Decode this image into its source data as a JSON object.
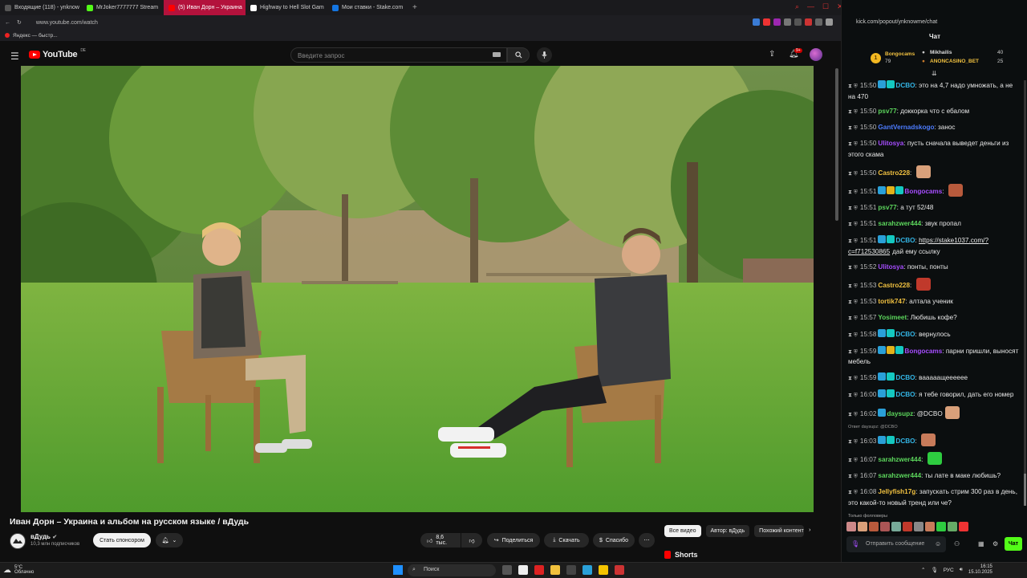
{
  "browser": {
    "tabs": [
      {
        "label": "Входящие (118) - ynknow",
        "color": "#555",
        "active": false
      },
      {
        "label": "MrJoker7777777 Stream",
        "color": "#53fc18",
        "active": false
      },
      {
        "label": "(5) Иван Дорн – Украина",
        "color": "#ff0000",
        "active": true
      },
      {
        "label": "Highway to Hell Slot Gam",
        "color": "#ffffff",
        "active": false
      },
      {
        "label": "Мои ставки - Stake.com",
        "color": "#1475e1",
        "active": false
      }
    ],
    "url": "www.youtube.com/watch",
    "bookmark": "Яндекс — быстр..."
  },
  "youtube": {
    "logo_text": "YouTube",
    "logo_region": "DE",
    "search_placeholder": "Введите запрос",
    "notification_count": "9+",
    "video": {
      "title": "Иван Дорн – Украина и альбом на русском языке / вДудь",
      "channel": "вДудь",
      "subscribers": "10,3 млн подписчиков",
      "sponsor_label": "Стать спонсором",
      "likes": "8,6 тыс.",
      "share_label": "Поделиться",
      "download_label": "Скачать",
      "thanks_label": "Спасибо"
    },
    "chips": [
      "Все видео",
      "Автор: вДудь",
      "Похожий контент"
    ],
    "shorts_label": "Shorts"
  },
  "chat": {
    "url": "kick.com/popout/ynknowme/chat",
    "title": "Чат",
    "leaderboard": {
      "first": {
        "name": "Bongocams",
        "value": "79"
      },
      "second": {
        "name": "Mikhailis",
        "value": "40"
      },
      "third": {
        "name": "ANONCASINO_BET",
        "value": "25"
      },
      "rank": "1"
    },
    "messages": [
      {
        "time": "15:50",
        "user": "DCBO",
        "color": "#33b5e5",
        "badges": [
          "#2aa0d8",
          "#14c8c0"
        ],
        "text": "это на 4,7 надо умножать, а не на 470"
      },
      {
        "time": "15:50",
        "user": "psv77",
        "color": "#5cd65c",
        "badges": [],
        "text": "доккорка что с ебалом"
      },
      {
        "time": "15:50",
        "user": "GantVernadskogo",
        "color": "#4d7cff",
        "badges": [],
        "text": "занос"
      },
      {
        "time": "15:50",
        "user": "Ulitosya",
        "color": "#a64dff",
        "badges": [],
        "text": "пусть сначала выведет деньги из этого скама"
      },
      {
        "time": "15:50",
        "user": "Castro228",
        "color": "#f0c040",
        "badges": [],
        "text": "",
        "emote": "#d9a07a"
      },
      {
        "time": "15:51",
        "user": "Bongocams",
        "color": "#a64dff",
        "badges": [
          "#2aa0d8",
          "#e2b21b",
          "#14c8c0"
        ],
        "text": "",
        "emote": "#b85a3c"
      },
      {
        "time": "15:51",
        "user": "psv77",
        "color": "#5cd65c",
        "badges": [],
        "text": "а тут 52/48"
      },
      {
        "time": "15:51",
        "user": "sarahzwer444",
        "color": "#5cd65c",
        "badges": [],
        "text": "звук пропал"
      },
      {
        "time": "15:51",
        "user": "DCBO",
        "color": "#33b5e5",
        "badges": [
          "#2aa0d8",
          "#14c8c0"
        ],
        "text": "",
        "link": "https://stake1037.com/?c=f712530865",
        "after": "дай ему ссылку"
      },
      {
        "time": "15:52",
        "user": "Ulitosya",
        "color": "#a64dff",
        "badges": [],
        "text": "понты, понты"
      },
      {
        "time": "15:53",
        "user": "Castro228",
        "color": "#f0c040",
        "badges": [],
        "text": "",
        "emote": "#c0392b"
      },
      {
        "time": "15:53",
        "user": "tortik747",
        "color": "#f0c040",
        "badges": [],
        "text": "алтала ученик"
      },
      {
        "time": "15:57",
        "user": "Yosimeet",
        "color": "#5cd65c",
        "badges": [],
        "text": "Любишь кофе?"
      },
      {
        "time": "15:58",
        "user": "DCBO",
        "color": "#33b5e5",
        "badges": [
          "#2aa0d8",
          "#14c8c0"
        ],
        "text": "вернулось"
      },
      {
        "time": "15:59",
        "user": "Bongocams",
        "color": "#a64dff",
        "badges": [
          "#2aa0d8",
          "#e2b21b",
          "#14c8c0"
        ],
        "text": "парни пришли, выносят мебель"
      },
      {
        "time": "15:59",
        "user": "DCBO",
        "color": "#33b5e5",
        "badges": [
          "#2aa0d8",
          "#14c8c0"
        ],
        "text": "вааааащееееее"
      },
      {
        "time": "16:00",
        "user": "DCBO",
        "color": "#33b5e5",
        "badges": [
          "#2aa0d8",
          "#14c8c0"
        ],
        "text": "я тебе говорил, дать его номер"
      },
      {
        "time": "16:02",
        "user": "daysupz",
        "color": "#5cd65c",
        "badges": [
          "#2aa0d8"
        ],
        "text": "@DCBO",
        "emote": "#d9a07a"
      },
      {
        "time": "16:03",
        "user": "DCBO",
        "color": "#33b5e5",
        "badges": [
          "#2aa0d8",
          "#14c8c0"
        ],
        "text": "",
        "emote": "#c87b5a",
        "reply": "Ответ daysupz: @DCBO"
      },
      {
        "time": "16:07",
        "user": "sarahzwer444",
        "color": "#5cd65c",
        "badges": [],
        "text": "",
        "emote": "#2ecc40"
      },
      {
        "time": "16:07",
        "user": "sarahzwer444",
        "color": "#5cd65c",
        "badges": [],
        "text": "ты лате в маке любишь?"
      },
      {
        "time": "16:08",
        "user": "Jellyfish17g",
        "color": "#f0c040",
        "badges": [],
        "text": "запускать стрим 300 раз в день, это какой-то новый тренд или че?"
      }
    ],
    "followers_note": "Только фолловеры",
    "input_placeholder": "Отправить сообщение",
    "send_label": "Чат"
  },
  "taskbar": {
    "temperature": "5°C",
    "weather": "Облачно",
    "search_label": "Поиск",
    "language": "РУС",
    "time": "16:15",
    "date": "15.10.2025"
  }
}
